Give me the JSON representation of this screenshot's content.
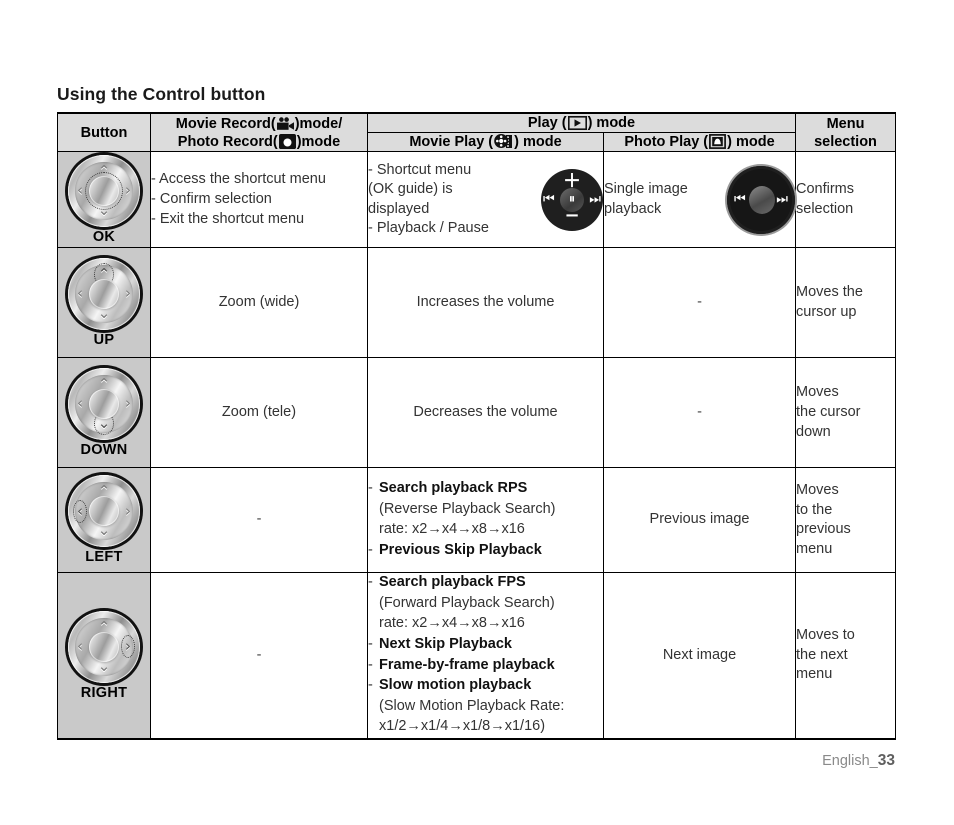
{
  "page": {
    "title": "Using the Control button",
    "footer_label": "English_",
    "footer_page": "33"
  },
  "table": {
    "headers": {
      "button": "Button",
      "record_line1": "Movie Record(",
      "record_line1_end": ")mode/",
      "record_line2": "Photo Record(",
      "record_line2_end": ")mode",
      "play_group_pre": "Play (",
      "play_group_post": ") mode",
      "movie_play_pre": "Movie Play (",
      "movie_play_post": ") mode",
      "photo_play_pre": "Photo Play (",
      "photo_play_post": ") mode",
      "menu_selection": "Menu\nselection",
      "menu_selection_line1": "Menu",
      "menu_selection_line2": "selection"
    },
    "icons": {
      "movie_record": "movie-camera-icon",
      "photo_record": "camera-icon",
      "play": "play-icon",
      "movie_play": "film-reel-icon",
      "photo_play": "photo-icon"
    },
    "rows": [
      {
        "button": "OK",
        "dpad_selected": "center",
        "record_mode": [
          "- Access the shortcut menu",
          "- Confirm selection",
          "- Exit the shortcut menu"
        ],
        "movie_play": [
          "- Shortcut menu",
          "(OK guide) is",
          "displayed",
          "- Playback / Pause"
        ],
        "movie_play_has_pad": true,
        "photo_play": [
          "Single image",
          "playback"
        ],
        "photo_play_has_pad": true,
        "menu_selection": [
          "Confirms",
          "selection"
        ]
      },
      {
        "button": "UP",
        "dpad_selected": "up",
        "record_mode": [
          "Zoom (wide)"
        ],
        "movie_play": [
          "Increases the volume"
        ],
        "movie_play_has_pad": false,
        "photo_play": [
          "-"
        ],
        "photo_play_has_pad": false,
        "menu_selection": [
          "Moves the",
          "cursor up"
        ]
      },
      {
        "button": "DOWN",
        "dpad_selected": "down",
        "record_mode": [
          "Zoom (tele)"
        ],
        "movie_play": [
          "Decreases the volume"
        ],
        "movie_play_has_pad": false,
        "photo_play": [
          "-"
        ],
        "photo_play_has_pad": false,
        "menu_selection": [
          "Moves",
          "the cursor",
          "down"
        ]
      },
      {
        "button": "LEFT",
        "dpad_selected": "left",
        "record_mode": [
          "-"
        ],
        "movie_play_rich": [
          {
            "dash": true,
            "bold": true,
            "text": "Search playback RPS"
          },
          {
            "dash": false,
            "bold": false,
            "text": "(Reverse Playback Search)"
          },
          {
            "dash": false,
            "bold": false,
            "text": "rate:  x2→x4→x8→x16"
          },
          {
            "dash": true,
            "bold": true,
            "text": "Previous Skip Playback"
          }
        ],
        "movie_play_has_pad": false,
        "photo_play": [
          "Previous image"
        ],
        "photo_play_has_pad": false,
        "menu_selection": [
          "Moves",
          "to the",
          "previous",
          "menu"
        ]
      },
      {
        "button": "RIGHT",
        "dpad_selected": "right",
        "record_mode": [
          "-"
        ],
        "movie_play_rich": [
          {
            "dash": true,
            "bold": true,
            "text": "Search playback FPS"
          },
          {
            "dash": false,
            "bold": false,
            "text": "(Forward Playback Search)"
          },
          {
            "dash": false,
            "bold": false,
            "text": "rate:  x2→x4→x8→x16"
          },
          {
            "dash": true,
            "bold": true,
            "text": "Next Skip Playback"
          },
          {
            "dash": true,
            "bold": true,
            "text": "Frame-by-frame playback"
          },
          {
            "dash": true,
            "bold": true,
            "text": "Slow motion playback"
          },
          {
            "dash": false,
            "bold": false,
            "text": "(Slow Motion Playback Rate:"
          },
          {
            "dash": false,
            "bold": false,
            "text": "x1/2→x1/4→x1/8→x1/16)"
          }
        ],
        "movie_play_has_pad": false,
        "photo_play": [
          "Next image"
        ],
        "photo_play_has_pad": false,
        "menu_selection": [
          "Moves to",
          "the next",
          "menu"
        ]
      }
    ]
  },
  "colors": {
    "header_bg": "#dcdcdc",
    "button_col_bg": "#c9c9c9",
    "text": "#333333",
    "border": "#000000",
    "footer": "#8a8a8a"
  }
}
